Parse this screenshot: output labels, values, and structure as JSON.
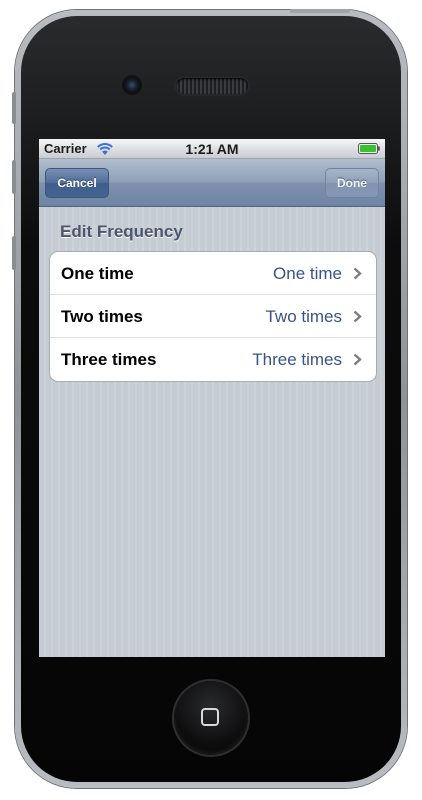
{
  "status_bar": {
    "carrier": "Carrier",
    "time": "1:21 AM",
    "wifi_icon": "wifi-icon",
    "battery_icon": "battery-icon",
    "battery_color": "#35c42d"
  },
  "nav_bar": {
    "cancel_label": "Cancel",
    "done_label": "Done"
  },
  "section": {
    "header": "Edit Frequency",
    "rows": [
      {
        "label": "One time",
        "value": "One time"
      },
      {
        "label": "Two times",
        "value": "Two times"
      },
      {
        "label": "Three times",
        "value": "Three times"
      }
    ]
  },
  "colors": {
    "nav_tint": "#6e84a3",
    "value_text": "#385487",
    "background": "#c5ccd4"
  }
}
